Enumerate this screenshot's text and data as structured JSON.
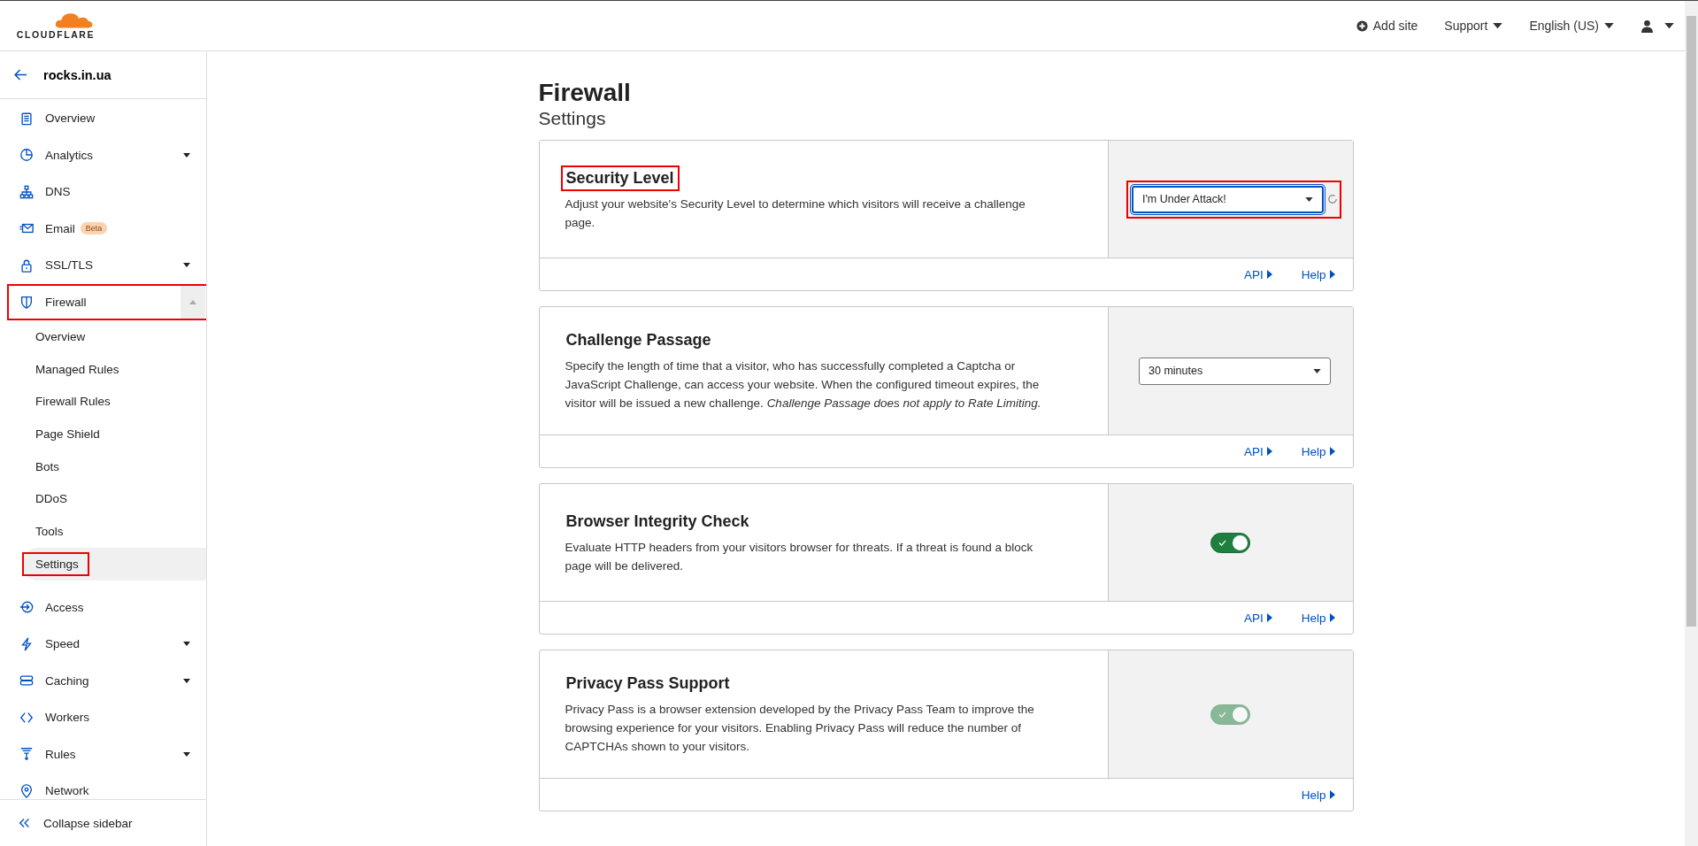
{
  "header": {
    "logo_text": "CLOUDFLARE",
    "actions": [
      {
        "kind": "add",
        "label": "Add site"
      },
      {
        "kind": "menu",
        "label": "Support"
      },
      {
        "kind": "menu",
        "label": "English (US)"
      },
      {
        "kind": "user"
      }
    ]
  },
  "sidebar": {
    "site": "rocks.in.ua",
    "items": [
      {
        "label": "Overview"
      },
      {
        "label": "Analytics",
        "expanded": false
      },
      {
        "label": "DNS"
      },
      {
        "label": "Email",
        "badge": "Beta"
      },
      {
        "label": "SSL/TLS",
        "expanded": false
      },
      {
        "label": "Firewall",
        "expanded": true,
        "highlighted": true,
        "children": [
          {
            "label": "Overview",
            "selected": false,
            "highlighted": false
          },
          {
            "label": "Managed Rules",
            "selected": false,
            "highlighted": false
          },
          {
            "label": "Firewall Rules",
            "selected": false,
            "highlighted": false
          },
          {
            "label": "Page Shield",
            "selected": false,
            "highlighted": false
          },
          {
            "label": "Bots",
            "selected": false,
            "highlighted": false
          },
          {
            "label": "DDoS",
            "selected": false,
            "highlighted": false
          },
          {
            "label": "Tools",
            "selected": false,
            "highlighted": false
          },
          {
            "label": "Settings",
            "selected": true,
            "highlighted": true
          }
        ]
      },
      {
        "label": "Access"
      },
      {
        "label": "Speed",
        "expanded": false
      },
      {
        "label": "Caching",
        "expanded": false
      },
      {
        "label": "Workers"
      },
      {
        "label": "Rules",
        "expanded": false
      },
      {
        "label": "Network"
      }
    ],
    "collapse": "Collapse sidebar"
  },
  "main": {
    "title": "Firewall",
    "subtitle": "Settings",
    "cards": [
      {
        "title": "Security Level",
        "highlighted": true,
        "description": "Adjust your website's Security Level to determine which visitors will receive a challenge page.",
        "control": {
          "kind": "select",
          "value": "I'm Under Attack!",
          "focused": true,
          "loading": true,
          "highlighted": true
        },
        "links": [
          "API",
          "Help"
        ]
      },
      {
        "title": "Challenge Passage",
        "highlighted": false,
        "description": "Specify the length of time that a visitor, who has successfully completed a Captcha or JavaScript Challenge, can access your website. When the configured timeout expires, the visitor will be issued a new challenge. *Challenge Passage does not apply to Rate Limiting.*",
        "control": {
          "kind": "select",
          "value": "30 minutes",
          "focused": false,
          "loading": false,
          "highlighted": false
        },
        "links": [
          "API",
          "Help"
        ]
      },
      {
        "title": "Browser Integrity Check",
        "highlighted": false,
        "description": "Evaluate HTTP headers from your visitors browser for threats. If a threat is found a block page will be delivered.",
        "control": {
          "kind": "toggle",
          "on": true,
          "disabled": false
        },
        "links": [
          "API",
          "Help"
        ]
      },
      {
        "title": "Privacy Pass Support",
        "highlighted": false,
        "description": "Privacy Pass is a browser extension developed by the Privacy Pass Team to improve the browsing experience for your visitors. Enabling Privacy Pass will reduce the number of CAPTCHAs shown to your visitors.",
        "control": {
          "kind": "toggle",
          "on": true,
          "disabled": true
        },
        "links": [
          "Help"
        ]
      }
    ]
  }
}
